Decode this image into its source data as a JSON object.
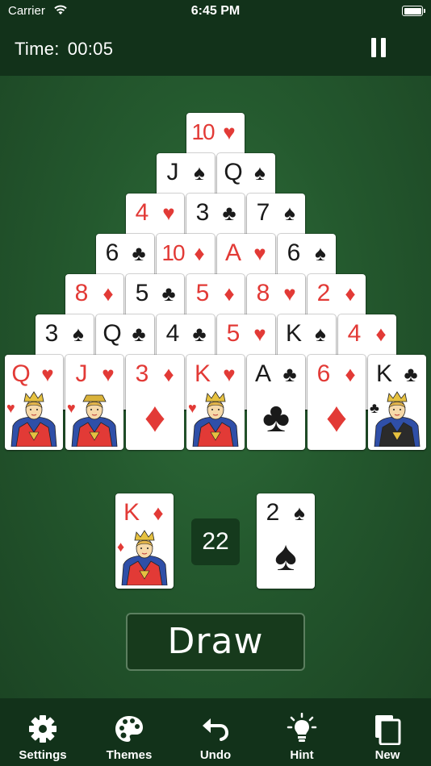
{
  "status_bar": {
    "carrier": "Carrier",
    "time": "6:45 PM"
  },
  "header": {
    "time_label": "Time:",
    "time_value": "00:05"
  },
  "pyramid": [
    {
      "rank": "10",
      "suit": "♥",
      "color": "red"
    },
    {
      "rank": "J",
      "suit": "♠",
      "color": "black"
    },
    {
      "rank": "Q",
      "suit": "♠",
      "color": "black"
    },
    {
      "rank": "4",
      "suit": "♥",
      "color": "red"
    },
    {
      "rank": "3",
      "suit": "♣",
      "color": "black"
    },
    {
      "rank": "7",
      "suit": "♠",
      "color": "black"
    },
    {
      "rank": "6",
      "suit": "♣",
      "color": "black"
    },
    {
      "rank": "10",
      "suit": "♦",
      "color": "red"
    },
    {
      "rank": "A",
      "suit": "♥",
      "color": "red"
    },
    {
      "rank": "6",
      "suit": "♠",
      "color": "black"
    },
    {
      "rank": "8",
      "suit": "♦",
      "color": "red"
    },
    {
      "rank": "5",
      "suit": "♣",
      "color": "black"
    },
    {
      "rank": "5",
      "suit": "♦",
      "color": "red"
    },
    {
      "rank": "8",
      "suit": "♥",
      "color": "red"
    },
    {
      "rank": "2",
      "suit": "♦",
      "color": "red"
    },
    {
      "rank": "3",
      "suit": "♠",
      "color": "black"
    },
    {
      "rank": "Q",
      "suit": "♣",
      "color": "black"
    },
    {
      "rank": "4",
      "suit": "♣",
      "color": "black"
    },
    {
      "rank": "5",
      "suit": "♥",
      "color": "red"
    },
    {
      "rank": "K",
      "suit": "♠",
      "color": "black"
    },
    {
      "rank": "4",
      "suit": "♦",
      "color": "red"
    },
    {
      "rank": "Q",
      "suit": "♥",
      "color": "red",
      "face": "queen"
    },
    {
      "rank": "J",
      "suit": "♥",
      "color": "red",
      "face": "jack"
    },
    {
      "rank": "3",
      "suit": "♦",
      "color": "red",
      "big": "♦"
    },
    {
      "rank": "K",
      "suit": "♥",
      "color": "red",
      "face": "king"
    },
    {
      "rank": "A",
      "suit": "♣",
      "color": "black",
      "big": "♣"
    },
    {
      "rank": "6",
      "suit": "♦",
      "color": "red",
      "big": "♦"
    },
    {
      "rank": "K",
      "suit": "♣",
      "color": "black",
      "face": "king"
    }
  ],
  "waste_card": {
    "rank": "K",
    "suit": "♦",
    "color": "red",
    "face": "king"
  },
  "stock_count": "22",
  "stock_card": {
    "rank": "2",
    "suit": "♠",
    "color": "black",
    "big": "♠"
  },
  "draw_button": "Draw",
  "tabs": [
    {
      "label": "Settings",
      "icon": "gear-icon"
    },
    {
      "label": "Themes",
      "icon": "palette-icon"
    },
    {
      "label": "Undo",
      "icon": "undo-icon"
    },
    {
      "label": "Hint",
      "icon": "lightbulb-icon"
    },
    {
      "label": "New",
      "icon": "new-game-icon"
    }
  ],
  "colors": {
    "felt": "#24592e",
    "bar": "#12321a",
    "red_suit": "#e23a36",
    "black_suit": "#1a1a1a"
  }
}
